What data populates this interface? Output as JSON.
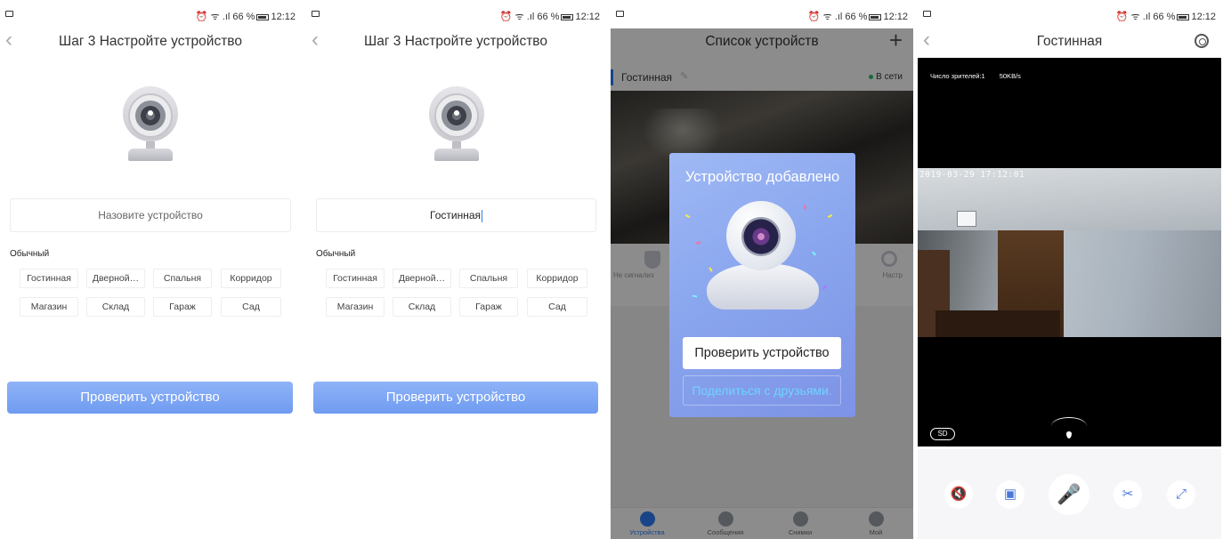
{
  "status": {
    "right": "⏰ ᯤ .ıl 66 %",
    "time": "12:12"
  },
  "screen1": {
    "title": "Шаг 3 Настройте устройство",
    "name_placeholder": "Назовите устройство",
    "section": "Обычный",
    "chips": [
      "Гостинная",
      "Дверной…",
      "Спальня",
      "Корридор",
      "Магазин",
      "Склад",
      "Гараж",
      "Сад"
    ],
    "button": "Проверить устройство"
  },
  "screen2": {
    "title": "Шаг 3 Настройте устройство",
    "name_value": "Гостинная",
    "section": "Обычный",
    "chips": [
      "Гостинная",
      "Дверной…",
      "Спальня",
      "Корридор",
      "Магазин",
      "Склад",
      "Гараж",
      "Сад"
    ],
    "button": "Проверить устройство"
  },
  "screen3": {
    "title": "Список устройств",
    "device_name": "Гостинная",
    "online_label": "В сети",
    "left_action": "Не сигнализ",
    "right_action": "Настр",
    "modal": {
      "title": "Устройство добавлено",
      "check_button": "Проверить устройство",
      "share_button": "Поделиться с друзьями."
    },
    "tabs": [
      "Устройства",
      "Сообщения",
      "Снимки",
      "Мой"
    ]
  },
  "screen4": {
    "title": "Гостинная",
    "viewers": "Число зрителей:1",
    "bitrate": "50KB/s",
    "timestamp": "2019-03-29 17:12:01",
    "quality": "SD"
  },
  "colors": {
    "accent": "#2e7cf6",
    "button": "#7fa5f3",
    "online": "#2bc46b",
    "share_text": "#6fd3ff"
  }
}
